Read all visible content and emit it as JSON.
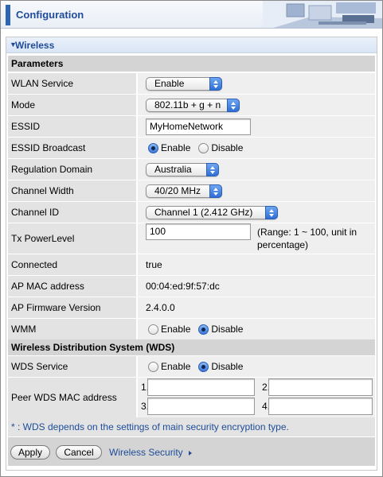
{
  "header": {
    "title": "Configuration"
  },
  "section": {
    "title": "Wireless"
  },
  "parameters": {
    "heading": "Parameters",
    "wlan_service": {
      "label": "WLAN Service",
      "value": "Enable"
    },
    "mode": {
      "label": "Mode",
      "value": "802.11b + g + n"
    },
    "essid": {
      "label": "ESSID",
      "value": "MyHomeNetwork"
    },
    "essid_broadcast": {
      "label": "ESSID Broadcast",
      "options": [
        "Enable",
        "Disable"
      ],
      "selected": "Enable"
    },
    "regulation_domain": {
      "label": "Regulation Domain",
      "value": "Australia"
    },
    "channel_width": {
      "label": "Channel Width",
      "value": "40/20 MHz"
    },
    "channel_id": {
      "label": "Channel ID",
      "value": "Channel 1 (2.412 GHz)"
    },
    "tx_power": {
      "label": "Tx PowerLevel",
      "value": "100",
      "hint_line1": "(Range: 1 ~ 100, unit in",
      "hint_line2": "percentage)"
    },
    "connected": {
      "label": "Connected",
      "value": "true"
    },
    "ap_mac": {
      "label": "AP MAC address",
      "value": "00:04:ed:9f:57:dc"
    },
    "ap_firmware": {
      "label": "AP Firmware Version",
      "value": "2.4.0.0"
    },
    "wmm": {
      "label": "WMM",
      "options": [
        "Enable",
        "Disable"
      ],
      "selected": "Disable"
    }
  },
  "wds": {
    "heading": "Wireless Distribution System (WDS)",
    "service": {
      "label": "WDS Service",
      "options": [
        "Enable",
        "Disable"
      ],
      "selected": "Disable"
    },
    "peer_mac": {
      "label": "Peer WDS MAC address",
      "fields": [
        {
          "num": "1.",
          "value": ""
        },
        {
          "num": "2.",
          "value": ""
        },
        {
          "num": "3.",
          "value": ""
        },
        {
          "num": "4.",
          "value": ""
        }
      ]
    },
    "note": "* : WDS depends on the settings of main security encryption type."
  },
  "footer": {
    "apply_label": "Apply",
    "cancel_label": "Cancel",
    "link_label": "Wireless Security"
  }
}
